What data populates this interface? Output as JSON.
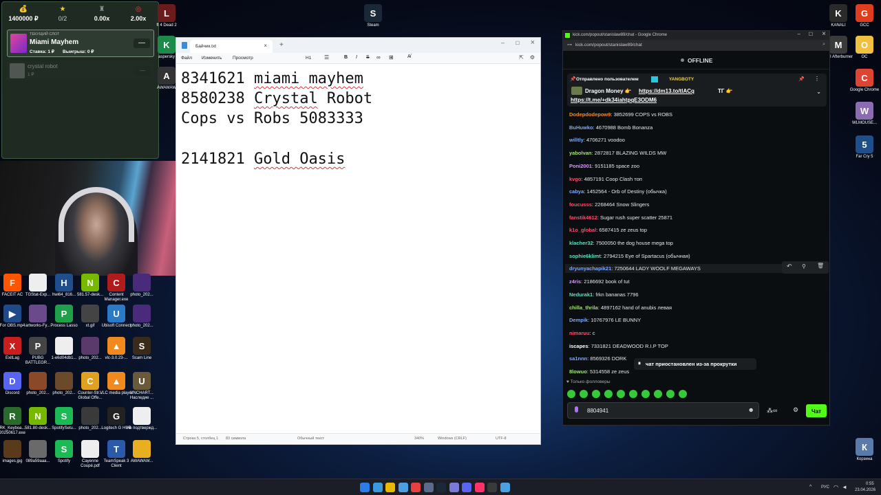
{
  "slot_widget": {
    "stats": [
      {
        "icon": "money-bag-icon",
        "value": "1400000 ₽"
      },
      {
        "icon": "star-icon",
        "value": "0/2"
      },
      {
        "icon": "trophy-icon",
        "value": "0.00x"
      },
      {
        "icon": "target-icon",
        "value": "2.00x"
      }
    ],
    "current_label": "ТЕКУЩИЙ СЛОТ",
    "current_name": "Miami Mayhem",
    "current_bet": "Ставка: 1 ₽",
    "current_win": "Выигрыш: 0 ₽",
    "next_name": "crystal robot",
    "next_bet": "1 ₽"
  },
  "desktop_icons": [
    {
      "label": "Steam",
      "color": "#1b2838",
      "glyph": "S"
    },
    {
      "label": "ft 4 Dead 2",
      "color": "#6a1c1c",
      "glyph": "L"
    },
    {
      "label": "aspersky",
      "color": "#1d8a4a",
      "glyph": "K"
    },
    {
      "label": "AWAWAW",
      "color": "#333",
      "glyph": "A"
    },
    {
      "label": "KANALI",
      "color": "#2a2a2a",
      "glyph": "K"
    },
    {
      "label": "GCC",
      "color": "#e03c1e",
      "glyph": "G"
    },
    {
      "label": "MSI Afterburner",
      "color": "#3a3a3a",
      "glyph": "M"
    },
    {
      "label": "OC",
      "color": "#f0c040",
      "glyph": "O"
    },
    {
      "label": "Google Chrome",
      "color": "#dd4433",
      "glyph": "C"
    },
    {
      "label": "WLMOUSE...",
      "color": "#8a6db0",
      "glyph": "W"
    },
    {
      "label": "Far Cry 5",
      "color": "#1f4f8a",
      "glyph": "5"
    },
    {
      "label": "Корзина",
      "color": "#5a7aa8",
      "glyph": "К"
    },
    {
      "label": "FACEIT AC",
      "color": "#ff5500",
      "glyph": "F"
    },
    {
      "label": "TGStat-Exp...",
      "color": "#eeeeee",
      "glyph": ""
    },
    {
      "label": "hwi64_816...",
      "color": "#1e4f8a",
      "glyph": "H"
    },
    {
      "label": "581.57-desk...",
      "color": "#76b900",
      "glyph": "N"
    },
    {
      "label": "Content Manager.exe",
      "color": "#b01c1c",
      "glyph": "C"
    },
    {
      "label": "photo_202...",
      "color": "#4a2a7a",
      "glyph": ""
    },
    {
      "label": "For OBS.mp4",
      "color": "#1f4a8a",
      "glyph": "▶"
    },
    {
      "label": "artworks-Fy...",
      "color": "#6a4a8a",
      "glyph": ""
    },
    {
      "label": "Process Lasso",
      "color": "#1ea04a",
      "glyph": "P"
    },
    {
      "label": "xt.gif",
      "color": "#444",
      "glyph": ""
    },
    {
      "label": "Ubisoft Connect",
      "color": "#2a7ac8",
      "glyph": "U"
    },
    {
      "label": "photo_202...",
      "color": "#4a2a7a",
      "glyph": ""
    },
    {
      "label": "ExitLag",
      "color": "#c81e1e",
      "glyph": "X"
    },
    {
      "label": "PUBG BATTLEGR...",
      "color": "#444",
      "glyph": "P"
    },
    {
      "label": "1-e6d04db1...",
      "color": "#eeeeee",
      "glyph": ""
    },
    {
      "label": "photo_202...",
      "color": "#5a3a6a",
      "glyph": ""
    },
    {
      "label": "vlc-3.0.23-...",
      "color": "#f08a1e",
      "glyph": "▲"
    },
    {
      "label": "Scam Line",
      "color": "#3a2a1a",
      "glyph": "S"
    },
    {
      "label": "Discord",
      "color": "#5865f2",
      "glyph": "D"
    },
    {
      "label": "photo_202...",
      "color": "#8a4a2a",
      "glyph": ""
    },
    {
      "label": "photo_202...",
      "color": "#6a4a2a",
      "glyph": ""
    },
    {
      "label": "Counter-Str... Global Offe...",
      "color": "#e0a020",
      "glyph": "C"
    },
    {
      "label": "VLC media player",
      "color": "#f08a1e",
      "glyph": "▲"
    },
    {
      "label": "UNCHART... Наследие ...",
      "color": "#6a5a3a",
      "glyph": "U"
    },
    {
      "label": "RK_Keyboa... 20250617.exe",
      "color": "#2a6a2a",
      "glyph": "R"
    },
    {
      "label": "581.80-desk...",
      "color": "#76b900",
      "glyph": "N"
    },
    {
      "label": "SpotifySetu...",
      "color": "#1db954",
      "glyph": "S"
    },
    {
      "label": "photo_202...",
      "color": "#3a3a3a",
      "glyph": ""
    },
    {
      "label": "Logitech G HUB",
      "color": "#222",
      "glyph": "G"
    },
    {
      "label": "Не подтвержд...",
      "color": "#eeeeee",
      "glyph": ""
    },
    {
      "label": "images.jpg",
      "color": "#5a3a1a",
      "glyph": ""
    },
    {
      "label": "089a59aaa...",
      "color": "#6a6a6a",
      "glyph": ""
    },
    {
      "label": "Spotify",
      "color": "#1db954",
      "glyph": "S"
    },
    {
      "label": "Cayenne Coupé.pdf",
      "color": "#eeeeee",
      "glyph": ""
    },
    {
      "label": "TeamSpeak 3 Client",
      "color": "#2a5aa8",
      "glyph": "T"
    },
    {
      "label": "AWAWAW...",
      "color": "#e8b020",
      "glyph": ""
    }
  ],
  "notepad": {
    "tab_title": "Байчик.txt",
    "menu": [
      "Файл",
      "Изменить",
      "Просмотр"
    ],
    "heading_select": "H1",
    "lines": [
      {
        "a": "8341621 ",
        "b": "miami mayhem",
        "c": ""
      },
      {
        "a": "8580238 ",
        "b": "Crystal",
        "c": " Robot"
      },
      {
        "a": "Cops vs Robs 5083333",
        "b": "",
        "c": ""
      },
      {
        "a": "2141821 ",
        "b": "Gold Oasis",
        "c": ""
      }
    ],
    "status": {
      "position": "Строка 5, столбец 1",
      "chars": "83 символа",
      "format": "Обычный текст",
      "zoom": "340%",
      "eol": "Windows (CRLF)",
      "encoding": "UTF-8"
    }
  },
  "chrome": {
    "window_title": "kick.com/popout/stanislaw89/chat - Google Chrome",
    "url": "kick.com/popout/stanislaw89/chat",
    "stream_status": "OFFLINE",
    "pinned_by": "Отправлено пользователем",
    "pinned_user": "YANGBOTY",
    "pinned_line1_a": "Dragon Money 👉",
    "pinned_link1": "https://dm13.to/tlACq",
    "pinned_line1_b": "ТГ 👉",
    "pinned_link2": "https://t.me/+dk34iahtpqE3ODM6",
    "messages": [
      {
        "user": "Dodepdodepow9",
        "text": "3852699 COPS vs ROBS",
        "color": "#f28c28"
      },
      {
        "user": "BuHuwko",
        "text": "4670988 Bomb Bonanza",
        "color": "#7fa8ff"
      },
      {
        "user": "willtly",
        "text": "4706271 voodoo",
        "color": "#7fa8ff"
      },
      {
        "user": "yabolvan",
        "text": "2872817 BLAZING WILDS MW",
        "color": "#9fe870"
      },
      {
        "user": "Poni2001",
        "text": "9151185 space zoo",
        "color": "#d39bff"
      },
      {
        "user": "kvgo",
        "text": "4857191 Coop Clash топ",
        "color": "#ff4d6d"
      },
      {
        "user": "cabya",
        "text": "1452564 - Orb of Destiny (обычка)",
        "color": "#7fa8ff"
      },
      {
        "user": "foucusss",
        "text": "2268464 Snow Slingers",
        "color": "#ff4d6d"
      },
      {
        "user": "fanstik4612",
        "text": "Sugar rush super scatter 25871",
        "color": "#ff4d6d"
      },
      {
        "user": "k1o_global",
        "text": "6587415 ze zeus top",
        "color": "#ff4d6d"
      },
      {
        "user": "klacher32",
        "text": "7500050 the dog house mega top",
        "color": "#5fe0c0"
      },
      {
        "user": "sophie6klimt",
        "text": "2794215 Eye of Spartacus (обычная)",
        "color": "#5fe0c0"
      },
      {
        "user": "dryunyachapik21",
        "text": "7250644 LADY WOOLF MEGAWAYS",
        "color": "#7fa8ff"
      },
      {
        "user": "z4ris",
        "text": "2186692 book of tut",
        "color": "#d39bff"
      },
      {
        "user": "Nedurak1",
        "text": "frkn bananas 7796",
        "color": "#5fe0c0"
      },
      {
        "user": "chilla_thrila",
        "text": "4897162 hand of anubis левая",
        "color": "#9fe870"
      },
      {
        "user": "Dempik",
        "text": "10767976 LE BUNNY",
        "color": "#7fa8ff"
      },
      {
        "user": "nimaruu",
        "text": "c",
        "color": "#ff4d6d"
      },
      {
        "user": "iscapes",
        "text": "7331821 DEADWOOD R.I.P TOP",
        "color": "#ffffff"
      },
      {
        "user": "sa1nnn",
        "text": "8569326 DORK",
        "color": "#7fa8ff"
      },
      {
        "user": "8lowuo",
        "text": "5314558 ze zeus",
        "color": "#9fe870"
      }
    ],
    "paused_notice": "чат приостановлен из-за прокрутки",
    "followers_only": "Только фолловеры",
    "input_value": "8804941",
    "send_label": "Чат"
  },
  "taskbar": {
    "lang": "РУС",
    "time": "0:55",
    "date": "23.04.2026"
  }
}
